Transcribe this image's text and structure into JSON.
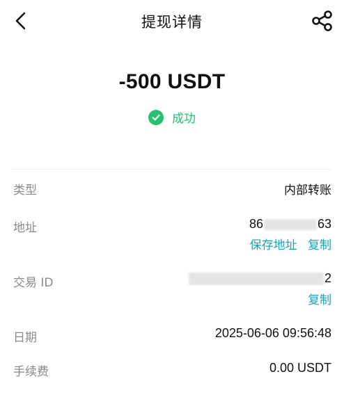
{
  "header": {
    "title": "提现详情",
    "back_icon": "chevron-left-icon",
    "share_icon": "share-icon"
  },
  "summary": {
    "amount": "-500 USDT",
    "status": "成功",
    "status_color": "#25c16f",
    "status_icon": "check-circle-icon"
  },
  "details": {
    "type": {
      "label": "类型",
      "value": "内部转账"
    },
    "address": {
      "label": "地址",
      "value_prefix": "86",
      "value_suffix": "63",
      "save_label": "保存地址",
      "copy_label": "复制"
    },
    "txid": {
      "label": "交易 ID",
      "value_suffix": "2",
      "copy_label": "复制"
    },
    "date": {
      "label": "日期",
      "value": "2025-06-06 09:56:48"
    },
    "fee": {
      "label": "手续费",
      "value": "0.00 USDT"
    }
  },
  "colors": {
    "link": "#17a5b8",
    "label": "#8a8a8a"
  }
}
